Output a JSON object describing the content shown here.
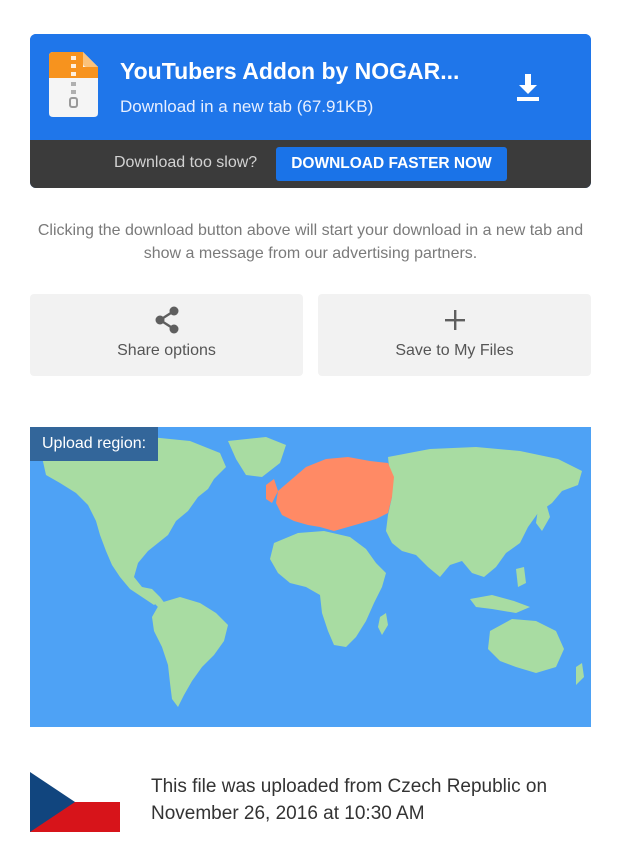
{
  "download": {
    "file_name": "YouTubers Addon by NOGAR...",
    "subtitle": "Download in a new tab (67.91KB)",
    "slow_prompt": "Download too slow?",
    "faster_button": "DOWNLOAD FASTER NOW",
    "icon": "zip-file-icon",
    "download_icon": "download-arrow-icon"
  },
  "notice": "Clicking the download button above will start your download in a new tab and show a message from our advertising partners.",
  "actions": {
    "share_label": "Share options",
    "share_icon": "share-icon",
    "save_label": "Save to My Files",
    "save_icon": "plus-icon"
  },
  "map": {
    "label": "Upload region:",
    "highlighted_region": "Europe",
    "colors": {
      "ocean": "#4ea2f5",
      "land": "#a8dca2",
      "highlight": "#ff8a65"
    }
  },
  "upload_info": {
    "text": "This file was uploaded from Czech Republic on November 26, 2016 at 10:30 AM",
    "flag": "czech-republic-flag"
  },
  "colors": {
    "accent": "#1a73e8",
    "dark_bar": "#3b3b3b"
  }
}
